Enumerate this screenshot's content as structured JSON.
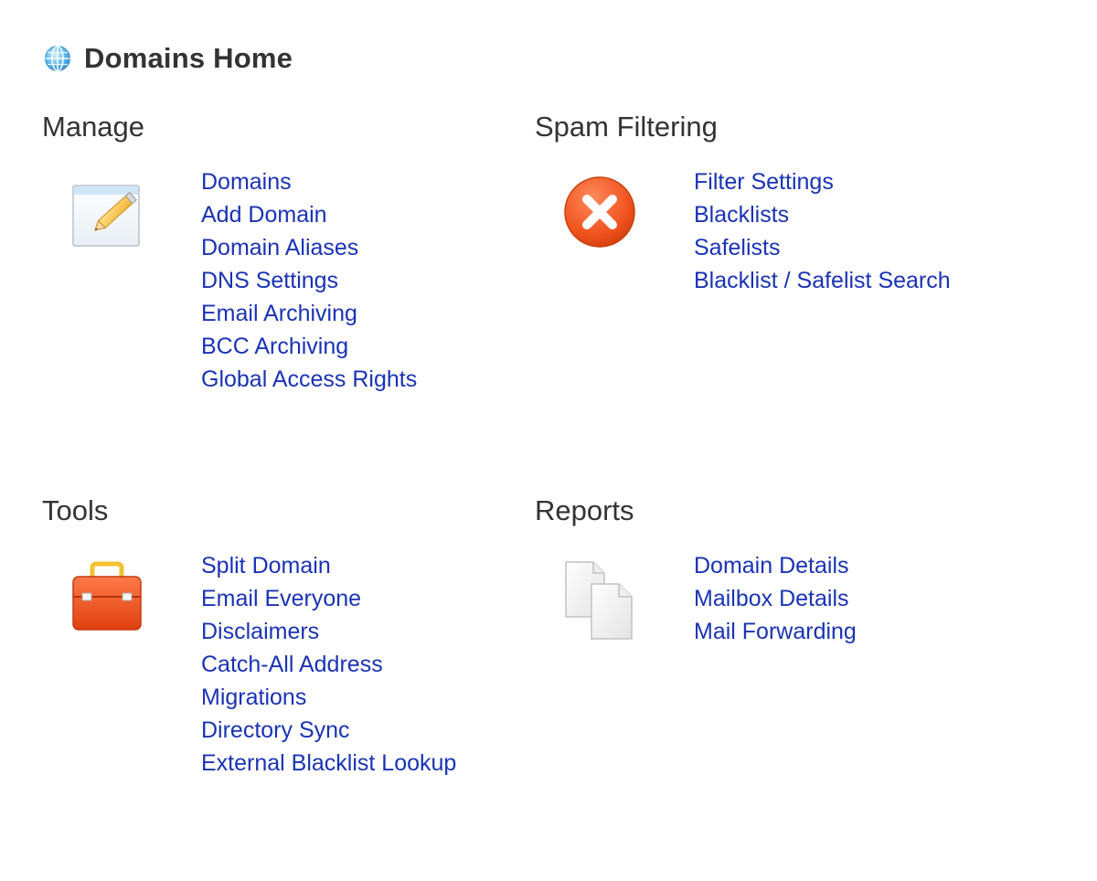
{
  "page": {
    "title": "Domains Home",
    "icon": "globe-icon"
  },
  "colors": {
    "link": "#1a33b3",
    "heading": "#333333",
    "background": "#ffffff"
  },
  "sections": {
    "manage": {
      "title": "Manage",
      "icon": "edit-document-icon",
      "links": [
        "Domains",
        "Add Domain",
        "Domain Aliases",
        "DNS Settings",
        "Email Archiving",
        "BCC Archiving",
        "Global Access Rights"
      ]
    },
    "spam": {
      "title": "Spam Filtering",
      "icon": "spam-block-icon",
      "links": [
        "Filter Settings",
        "Blacklists",
        "Safelists",
        "Blacklist / Safelist Search"
      ]
    },
    "tools": {
      "title": "Tools",
      "icon": "toolbox-icon",
      "links": [
        "Split Domain",
        "Email Everyone",
        "Disclaimers",
        "Catch-All Address",
        "Migrations",
        "Directory Sync",
        "External Blacklist Lookup"
      ]
    },
    "reports": {
      "title": "Reports",
      "icon": "report-documents-icon",
      "links": [
        "Domain Details",
        "Mailbox Details",
        "Mail Forwarding"
      ]
    }
  }
}
